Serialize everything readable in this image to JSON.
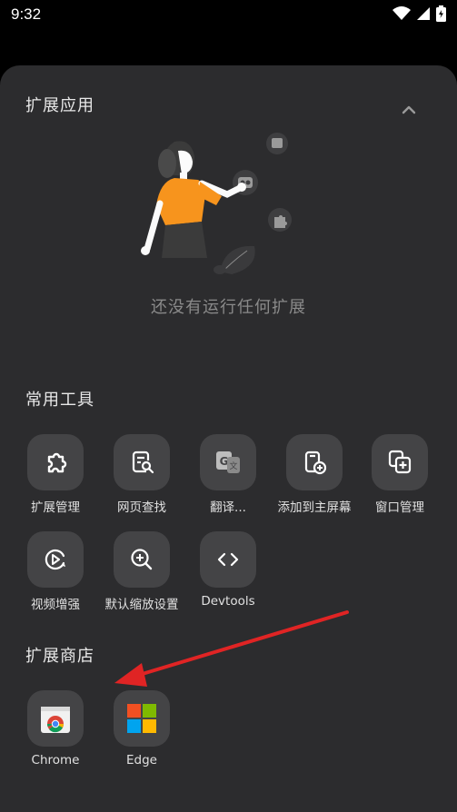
{
  "status_bar": {
    "time": "9:32",
    "icons": [
      "wifi-icon",
      "signal-icon",
      "battery-icon"
    ]
  },
  "sheet": {
    "title": "扩展应用",
    "collapse_icon": "chevron-up-icon",
    "empty_text": "还没有运行任何扩展"
  },
  "tools": {
    "title": "常用工具",
    "items": [
      {
        "label": "扩展管理",
        "icon": "puzzle-icon"
      },
      {
        "label": "网页查找",
        "icon": "page-search-icon"
      },
      {
        "label": "翻译...",
        "icon": "translate-icon"
      },
      {
        "label": "添加到主屏幕",
        "icon": "add-to-home-icon"
      },
      {
        "label": "窗口管理",
        "icon": "window-add-icon"
      },
      {
        "label": "视频增强",
        "icon": "video-enhance-icon"
      },
      {
        "label": "默认缩放设置",
        "icon": "zoom-icon"
      },
      {
        "label": "Devtools",
        "icon": "code-icon"
      }
    ]
  },
  "store": {
    "title": "扩展商店",
    "items": [
      {
        "label": "Chrome",
        "icon": "chrome-web-store-icon"
      },
      {
        "label": "Edge",
        "icon": "microsoft-logo-icon"
      }
    ]
  },
  "colors": {
    "sheet": "#2c2c2e",
    "tile": "#444446",
    "accent_orange": "#f7941d",
    "arrow_red": "#e02424"
  }
}
